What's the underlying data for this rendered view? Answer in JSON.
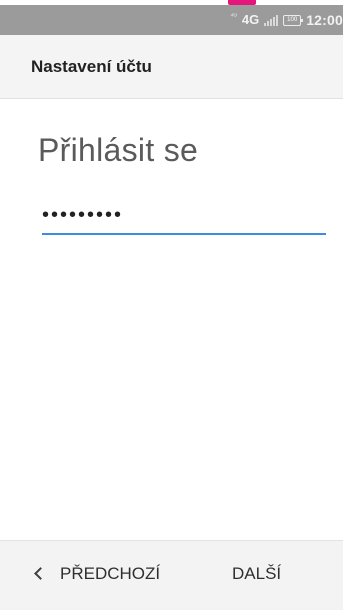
{
  "status_bar": {
    "network_superscript": "⁴ᴳ",
    "network_label": "4G",
    "battery_level": "100",
    "time": "12:00"
  },
  "toolbar": {
    "title": "Nastavení účtu"
  },
  "form": {
    "heading": "Přihlásit se",
    "password_value": "•••••••••"
  },
  "bottom_nav": {
    "previous_label": "PŘEDCHOZÍ",
    "next_label": "DALŠÍ"
  },
  "colors": {
    "status_bar": "#9b9b9b",
    "toolbar": "#f4f4f4",
    "accent_field_underline": "#3b8ce3",
    "top_accent_mark": "#e6157d"
  },
  "icons": {
    "signal": "signal-strength-icon",
    "battery": "battery-icon",
    "back": "chevron-left-icon"
  }
}
